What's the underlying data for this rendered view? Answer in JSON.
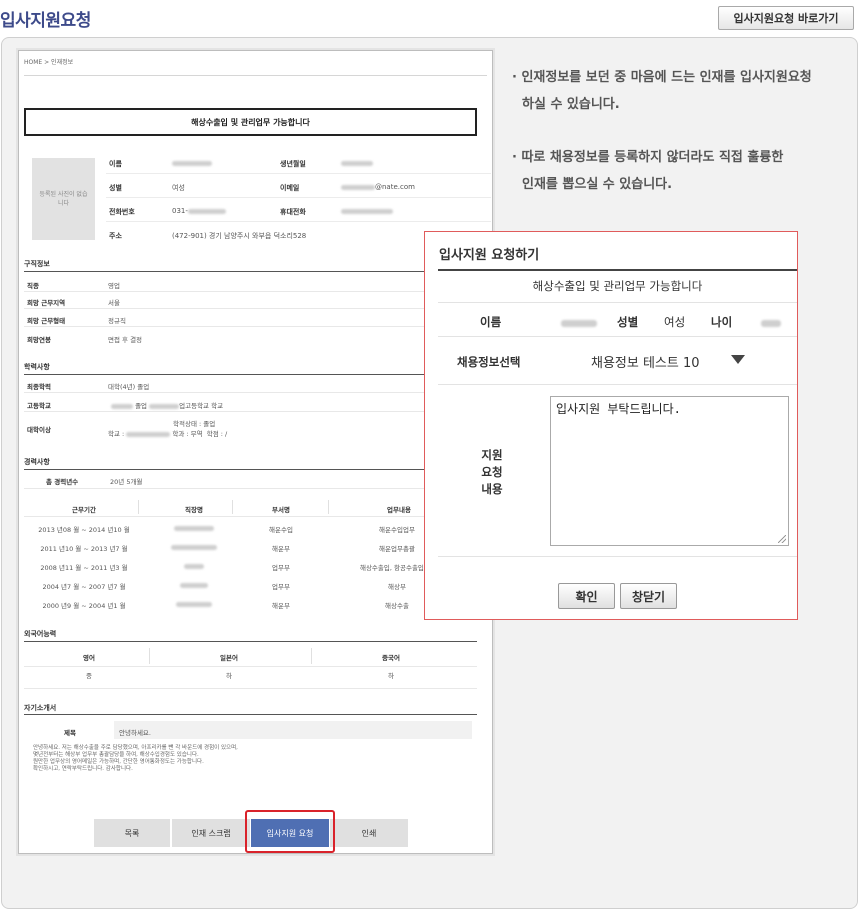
{
  "page": {
    "title": "입사지원요청",
    "shortcut_label": "입사지원요청 바로가기"
  },
  "doc": {
    "breadcrumb": "HOME > 인재정보",
    "headline": "해상수출입 및 관리업무 가능합니다",
    "photo_placeholder": "등록된 사진이 없습니다",
    "profile": {
      "name_label": "이름",
      "birth_label": "생년월일",
      "gender_label": "성별",
      "gender_value": "여성",
      "email_label": "이메일",
      "email_suffix": "@nate.com",
      "phone_label": "전화번호",
      "phone_prefix": "031-",
      "mobile_label": "휴대전화",
      "address_label": "주소",
      "address_value": "(472-901) 경기 남양주시 와부읍 덕소리528"
    },
    "job_section": {
      "title": "구직정보",
      "rows": [
        {
          "label": "직종",
          "value": "영업"
        },
        {
          "label": "희망 근무지역",
          "value": "서울"
        },
        {
          "label": "희망 근무형태",
          "value": "정규직"
        },
        {
          "label": "희망연봉",
          "value": "면접 후 결정"
        }
      ]
    },
    "edu_section": {
      "title": "학력사항",
      "final_label": "최종학력",
      "final_value": "대학(4년) 졸업",
      "high_label": "고등학교",
      "high_mid": "졸업",
      "high_suffix": "업고등학교 학교",
      "univ_label": "대학이상",
      "univ_line1": "학적상태 : 졸업",
      "univ_line2_a": "학교 :",
      "univ_line2_b": "학과 : 무역",
      "univ_line2_c": "학점 : /"
    },
    "career_section": {
      "title": "경력사항",
      "total_label": "총 경력년수",
      "total_value": "20년 5개월",
      "headers": [
        "근무기간",
        "직장명",
        "부서명",
        "업무내용"
      ],
      "rows": [
        {
          "period": "2013 년08 월 ~ 2014 년10 월",
          "dept": "해운수입",
          "task": "해운수입업무"
        },
        {
          "period": "2011 년10 월 ~ 2013 년7 월",
          "dept": "해운부",
          "task": "해운업무총괄"
        },
        {
          "period": "2008 년11 월 ~ 2011 년3 월",
          "dept": "업무부",
          "task": "해상수출입, 항공수출입, 관"
        },
        {
          "period": "2004 년7 월 ~ 2007 년7 월",
          "dept": "업무부",
          "task": "해상부"
        },
        {
          "period": "2000 년9 월 ~ 2004 년1 월",
          "dept": "해운부",
          "task": "해상수출"
        }
      ]
    },
    "lang_section": {
      "title": "외국어능력",
      "headers": [
        "영어",
        "일본어",
        "중국어"
      ],
      "values": [
        "중",
        "하",
        "하"
      ]
    },
    "self_section": {
      "title": "자기소개서",
      "subject_label": "제목",
      "subject_value": "안녕하세요.",
      "lines": [
        "안녕하세요. 저는 해상수출을 주로 담당했으며, 아프리카를 뺀 각 바운드에 경험이 있으며,",
        "몇년전부터는 해상부 업무부 총괄담당을 하여, 해상수입경험도 있습니다.",
        "원만한 업무상의 영어메일은 가능하며, 간단한 영어통화정도는 가능합니다.",
        "확인하시고, 연락부탁드립니다. 감사합니다."
      ]
    },
    "buttons": {
      "list": "목록",
      "scrap": "인재 스크랩",
      "request": "입사지원 요청",
      "print": "인쇄"
    }
  },
  "tips": {
    "tip1_line1": "· 인재정보를 보던 중 마음에 드는 인재를 입사지원요청",
    "tip1_line2": "하실 수 있습니다.",
    "tip2_line1": "· 따로 채용정보를 등록하지 않더라도 직접 훌륭한",
    "tip2_line2": "인재를 뽑으실 수 있습니다."
  },
  "dialog": {
    "title": "입사지원 요청하기",
    "headline": "해상수출입 및 관리업무 가능합니다",
    "name_label": "이름",
    "gender_label": "성별",
    "gender_value": "여성",
    "age_label": "나이",
    "select_label": "채용정보선택",
    "select_value": "채용정보 테스트 10",
    "request_label_1": "지원",
    "request_label_2": "요청",
    "request_label_3": "내용",
    "textarea_value": "입사지원 부탁드립니다.",
    "confirm_label": "확인",
    "close_label": "창닫기"
  }
}
